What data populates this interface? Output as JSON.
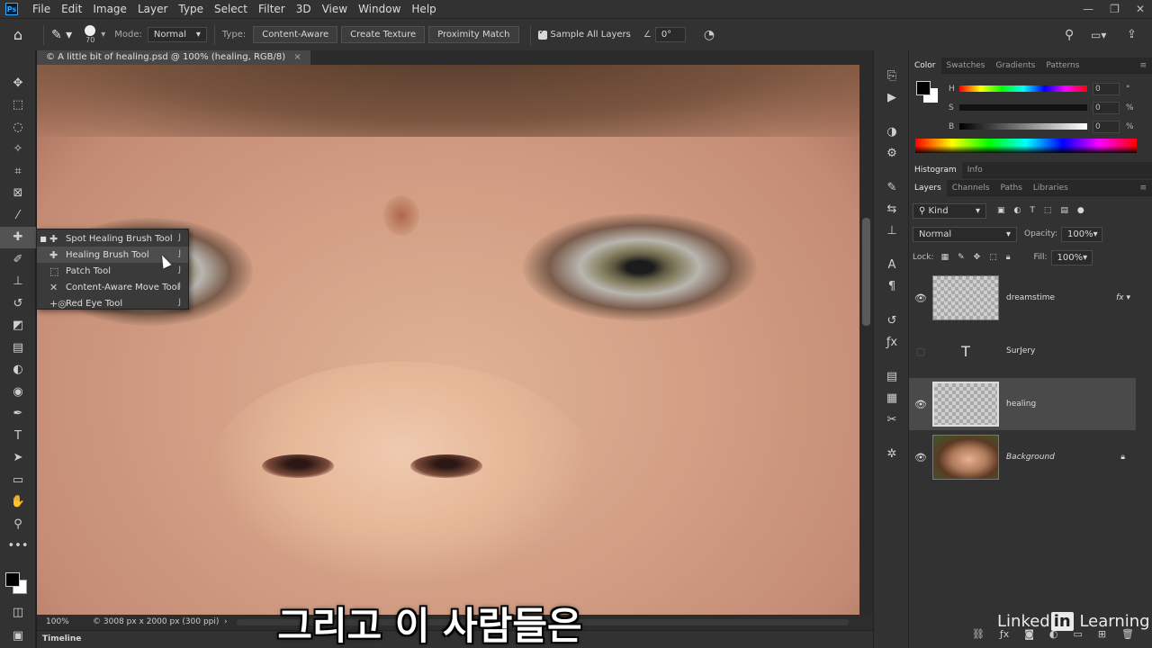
{
  "app": {
    "logo": "Ps"
  },
  "menubar": {
    "items": [
      "File",
      "Edit",
      "Image",
      "Layer",
      "Type",
      "Select",
      "Filter",
      "3D",
      "View",
      "Window",
      "Help"
    ]
  },
  "window_controls": [
    "minimize-icon",
    "restore-icon",
    "close-icon"
  ],
  "options": {
    "brush_size": "70",
    "mode_label": "Mode:",
    "mode_value": "Normal",
    "type_label": "Type:",
    "type_buttons": [
      "Content-Aware",
      "Create Texture",
      "Proximity Match"
    ],
    "sample_all_layers": "Sample All Layers",
    "angle": "0°"
  },
  "document": {
    "tab_title": "© A little bit of healing.psd @ 100% (healing, RGB/8)"
  },
  "flyout": {
    "items": [
      {
        "label": "Spot Healing Brush Tool",
        "key": "J",
        "icon": "spot-healing-icon"
      },
      {
        "label": "Healing Brush Tool",
        "key": "J",
        "icon": "healing-brush-icon"
      },
      {
        "label": "Patch Tool",
        "key": "J",
        "icon": "patch-icon"
      },
      {
        "label": "Content-Aware Move Tool",
        "key": "J",
        "icon": "move-aware-icon"
      },
      {
        "label": "Red Eye Tool",
        "key": "J",
        "icon": "red-eye-icon"
      }
    ]
  },
  "status": {
    "zoom": "100%",
    "doc_info": "3008 px x 2000 px (300 ppi)"
  },
  "timeline": {
    "label": "Timeline"
  },
  "subtitle": "그리고 이 사람들은",
  "color_panel": {
    "tabs": [
      "Color",
      "Swatches",
      "Gradients",
      "Patterns"
    ],
    "sliders": [
      {
        "label": "H",
        "value": "0",
        "unit": "°"
      },
      {
        "label": "S",
        "value": "0",
        "unit": "%"
      },
      {
        "label": "B",
        "value": "0",
        "unit": "%"
      }
    ]
  },
  "hist_tabs": [
    "Histogram",
    "Info"
  ],
  "layers_panel": {
    "tabs": [
      "Layers",
      "Channels",
      "Paths",
      "Libraries"
    ],
    "filter_kind": "Kind",
    "blend_mode": "Normal",
    "opacity_label": "Opacity:",
    "opacity_value": "100%",
    "lock_label": "Lock:",
    "fill_label": "Fill:",
    "fill_value": "100%",
    "layers": [
      {
        "name": "dreamstime",
        "type": "smart",
        "visible": true
      },
      {
        "name": "SurJery",
        "type": "text",
        "visible": false
      },
      {
        "name": "healing",
        "type": "pixel",
        "visible": true,
        "selected": true
      },
      {
        "name": "Background",
        "type": "background",
        "visible": true,
        "locked": true
      }
    ]
  },
  "brand": {
    "pre": "Linked",
    "mid": "in",
    "post": " Learning"
  },
  "colors": {
    "accent": "#31a8ff",
    "panel": "#323232",
    "selected_row": "#4a4a4a"
  }
}
